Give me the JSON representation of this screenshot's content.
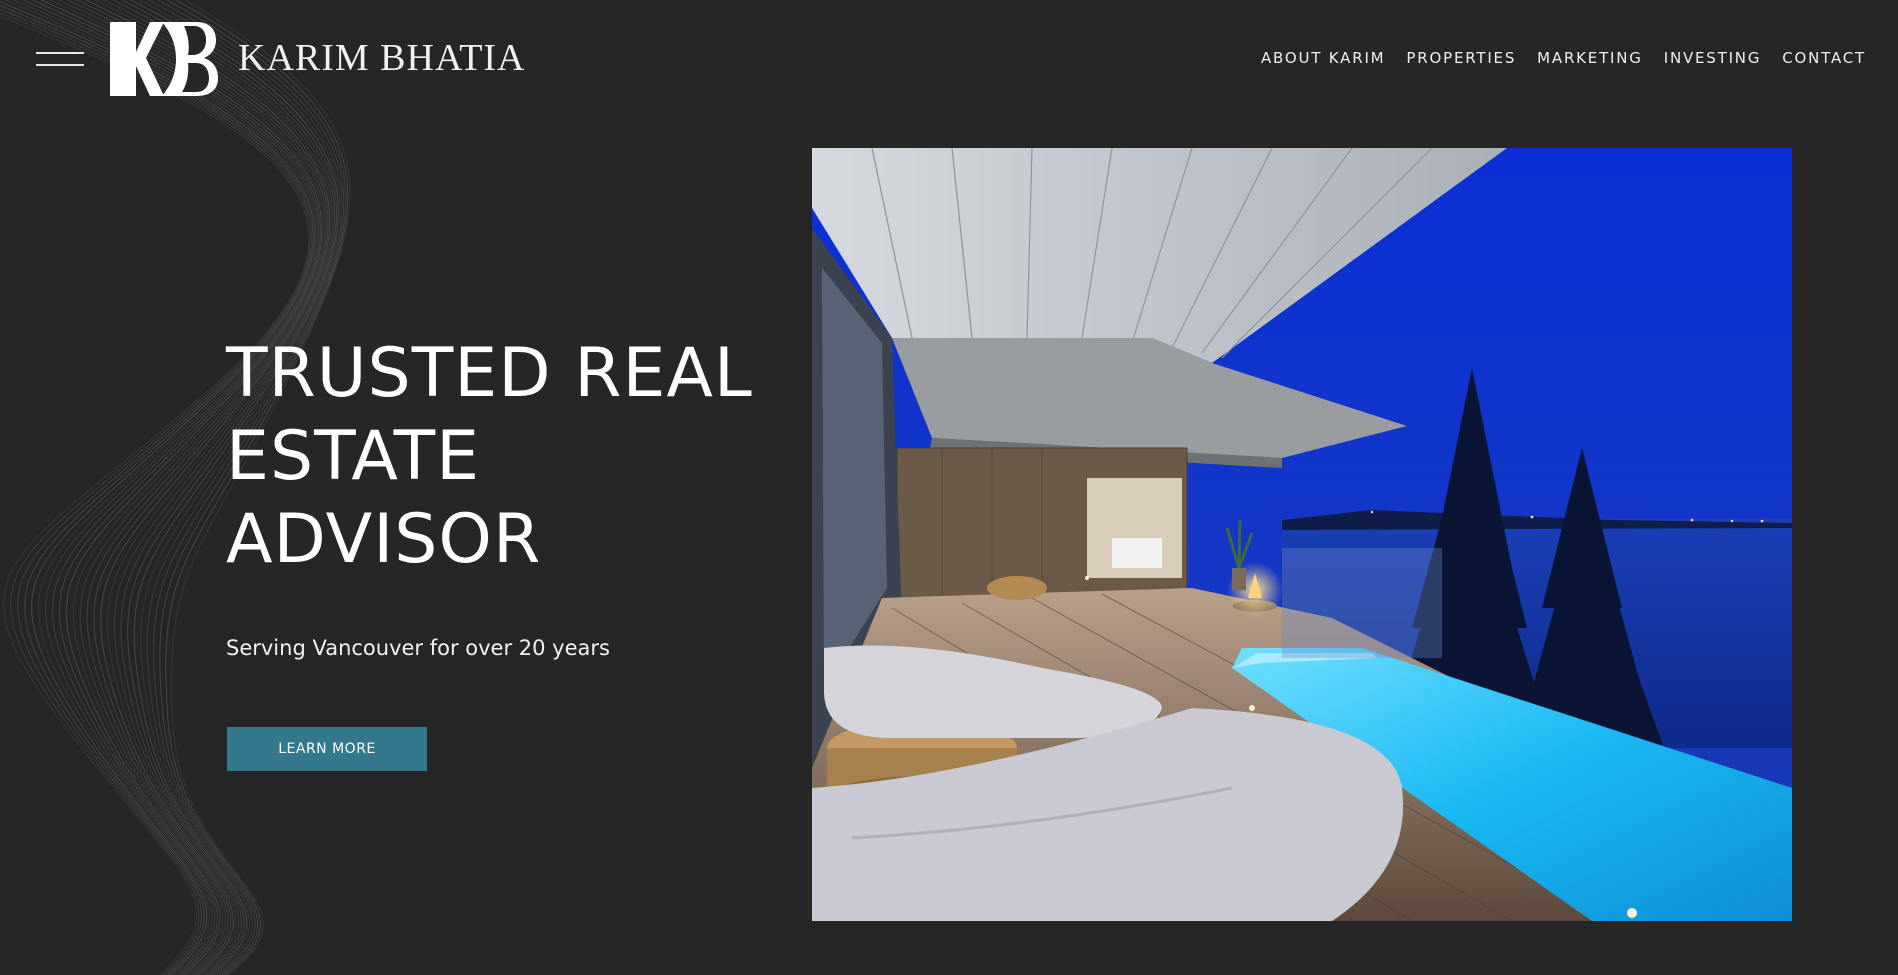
{
  "header": {
    "menu_icon": "hamburger-menu-icon",
    "logo_icon": "kb-monogram-logo",
    "brand_name": "KARIM BHATIA",
    "nav": [
      {
        "label": "ABOUT KARIM"
      },
      {
        "label": "PROPERTIES"
      },
      {
        "label": "MARKETING"
      },
      {
        "label": "INVESTING"
      },
      {
        "label": "CONTACT"
      }
    ]
  },
  "hero": {
    "title_lines": [
      "TRUSTED REAL",
      "ESTATE",
      "ADVISOR"
    ],
    "subtitle": "Serving Vancouver for over 20 years",
    "cta_label": "LEARN MORE",
    "image": "luxury-terrace-pool-at-dusk-photo"
  },
  "colors": {
    "background": "#262626",
    "accent": "#33788c",
    "text": "#ffffff"
  }
}
